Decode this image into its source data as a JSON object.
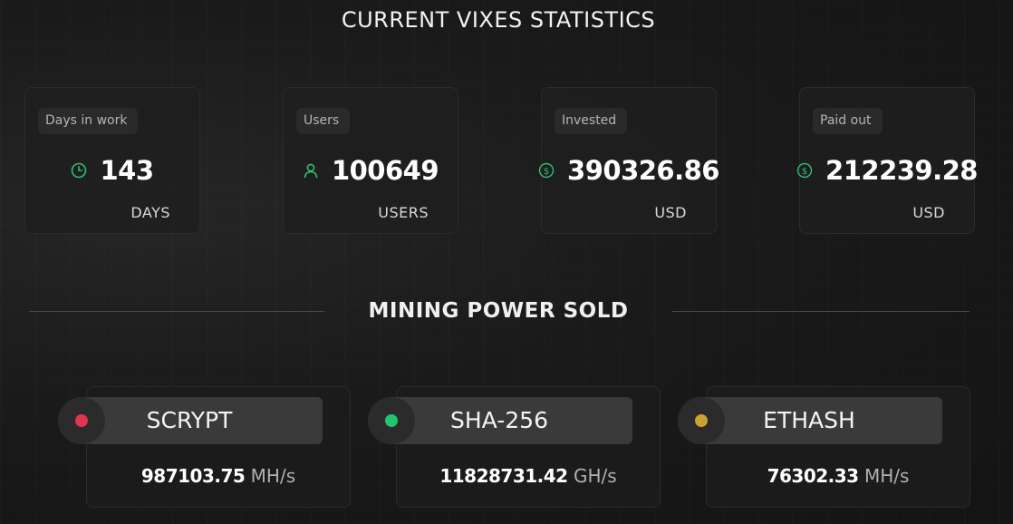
{
  "title": "CURRENT VIXES STATISTICS",
  "colors": {
    "accent_green": "#2fbf71",
    "dot_red": "#e0354f",
    "dot_green": "#22c46d",
    "dot_gold": "#c9a230"
  },
  "stats": [
    {
      "label": "Days in work",
      "value": "143",
      "unit": "DAYS",
      "icon": "clock-icon"
    },
    {
      "label": "Users",
      "value": "100649",
      "unit": "USERS",
      "icon": "user-icon"
    },
    {
      "label": "Invested",
      "value": "390326.86",
      "unit": "USD",
      "icon": "dollar-icon"
    },
    {
      "label": "Paid out",
      "value": "212239.28",
      "unit": "USD",
      "icon": "dollar-icon"
    }
  ],
  "mining": {
    "title": "MINING POWER SOLD",
    "items": [
      {
        "algo": "SCRYPT",
        "amount": "987103.75",
        "unit": "MH/s",
        "dot_color": "#e0354f"
      },
      {
        "algo": "SHA-256",
        "amount": "11828731.42",
        "unit": "GH/s",
        "dot_color": "#22c46d"
      },
      {
        "algo": "ETHASH",
        "amount": "76302.33",
        "unit": "MH/s",
        "dot_color": "#c9a230"
      }
    ]
  }
}
